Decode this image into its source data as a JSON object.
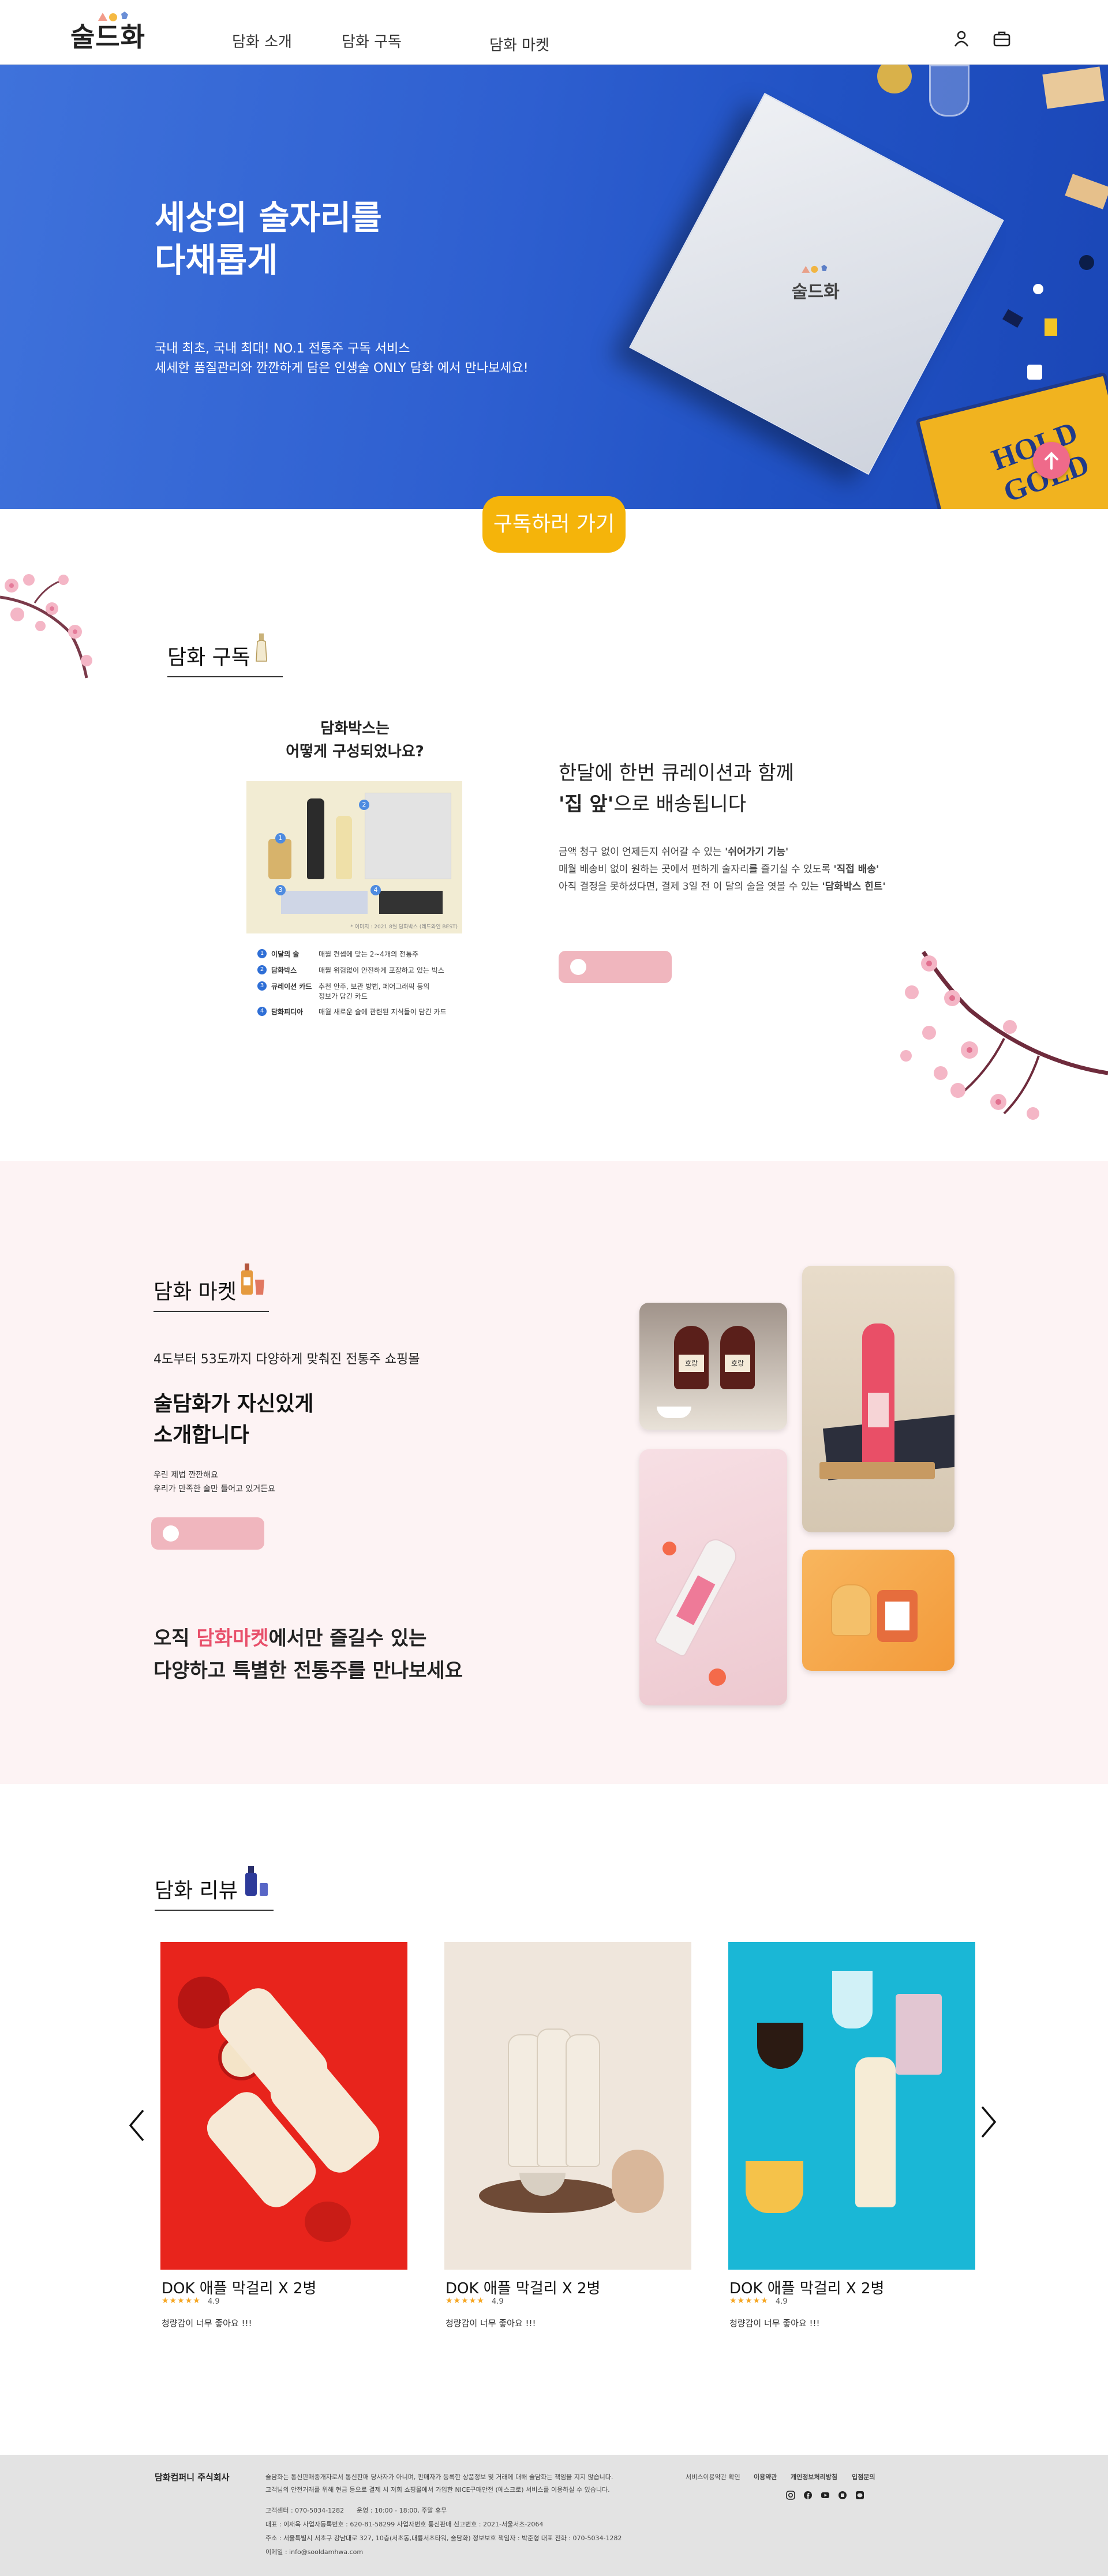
{
  "header": {
    "logo_text": "술드화",
    "nav": [
      "담화 소개",
      "담화 구독",
      "담화 마켓"
    ]
  },
  "hero": {
    "title_line1": "세상의 술자리를",
    "title_line2": "다채롭게",
    "sub_line1": "국내 최초, 국내 최대! NO.1 전통주 구독 서비스",
    "sub_line2": "세세한 품질관리와 깐깐하게 담은 인생술 ONLY 담화 에서 만나보세요!",
    "box_logo_text": "술드화",
    "cta_label": "구독하러 가기"
  },
  "subscribe": {
    "section_title": "담화 구독",
    "box_q1": "담화박스는",
    "box_q2": "어떻게 구성되었나요?",
    "legend": [
      {
        "num": "1",
        "title": "이달의 술",
        "desc": "매월 컨셉에 맞는 2~4개의 전통주"
      },
      {
        "num": "2",
        "title": "담화박스",
        "desc": "매월 위험없이 안전하게 포장하고 있는 박스"
      },
      {
        "num": "3",
        "title": "큐레이션 카드",
        "desc1": "추천 안주, 보관 방법, 페어그래픽 등의",
        "desc2": "정보가 담긴 카드"
      },
      {
        "num": "4",
        "title": "담화피디아",
        "desc": "매월 새로운 술에 관련된 지식들이 담긴 카드"
      }
    ],
    "photo_note": "* 이미지 : 2021 8월 담화박스 (레드와인 BEST)",
    "headline_line1": "한달에 한번 큐레이션과 함께",
    "headline_bold": "'집 앞'",
    "headline_rest": "으로 배송됩니다",
    "desc1_a": "금액 청구 없이 언제든지 쉬어갈 수 있는 ",
    "desc1_b": "'쉬어가기 기능'",
    "desc2_a": "매월 배송비 없이 원하는 곳에서 편하게 술자리를 즐기실 수 있도록 ",
    "desc2_b": "'직접 배송'",
    "desc3_a": "아직 결정을 못하셨다면, 결제 3일 전 이 달의 술을 엿볼 수 있는 ",
    "desc3_b": "'담화박스 힌트'"
  },
  "market": {
    "section_title": "담화 마켓",
    "lead": "4도부터 53도까지 다양하게 맞춰진 전통주 쇼핑몰",
    "headline1": "술담화가 자신있게",
    "headline2": "소개합니다",
    "small1": "우린 제법 깐깐해요",
    "small2": "우리가 만족한 술만 들어고 있거든요",
    "bottom1_a": "오직 ",
    "bottom1_accent": "담화마켓",
    "bottom1_b": "에서만 즐길수 있는",
    "bottom2": "다양하고 특별한 전통주를 만나보세요",
    "bottle_label_1": "호랑",
    "bottle_label_2": "호랑",
    "accent_color": "#e8506b"
  },
  "reviews": {
    "section_title": "담화 리뷰",
    "items": [
      {
        "name": "DOK 애플 막걸리 X 2병",
        "stars": "★★★★★",
        "rating": "4.9",
        "text": "청량감이 너무 좋아요 !!!"
      },
      {
        "name": "DOK 애플 막걸리 X 2병",
        "stars": "★★★★★",
        "rating": "4.9",
        "text": "청량감이 너무 좋아요 !!!"
      },
      {
        "name": "DOK 애플 막걸리 X 2병",
        "stars": "★★★★★",
        "rating": "4.9",
        "text": "청량감이 너무 좋아요 !!!"
      }
    ],
    "prev_arrow": "‹",
    "next_arrow": "›"
  },
  "footer": {
    "company": "담화컴퍼니 주식회사",
    "desc1": "술담화는 통신판매중개자로서 통신판매 당사자가 아니며, 판매자가 등록한 상품정보 및 거래에 대해 술담화는 책임을 지지 않습니다.",
    "desc2": "고객님의 안전거래를 위해 현금 등으로 결제 시 저희 쇼핑몰에서 가입한 NICE구매안전 (에스크로) 서비스를 이용하실 수 있습니다.",
    "cs": "고객센터 : 070-5034-1282",
    "hours": "운영 : 10:00 - 18:00, 주말 휴무",
    "ceo": "대표 : 이재욱   사업자등록번호 : 620-81-58299 사업자번호 통신판매 신고번호 : 2021-서울서초-2064",
    "addr": "주소 : 서울특별시 서초구 강남대로 327, 10층(서초동,대륭서초타워, 술담화)  정보보호 책임자 : 박준형  대표 전화 : 070-5034-1282",
    "email": "이메일 : info@sooldamhwa.com",
    "links": [
      "서비스이용약관 확인",
      "이용약관",
      "개인정보처리방침",
      "입점문의"
    ]
  }
}
